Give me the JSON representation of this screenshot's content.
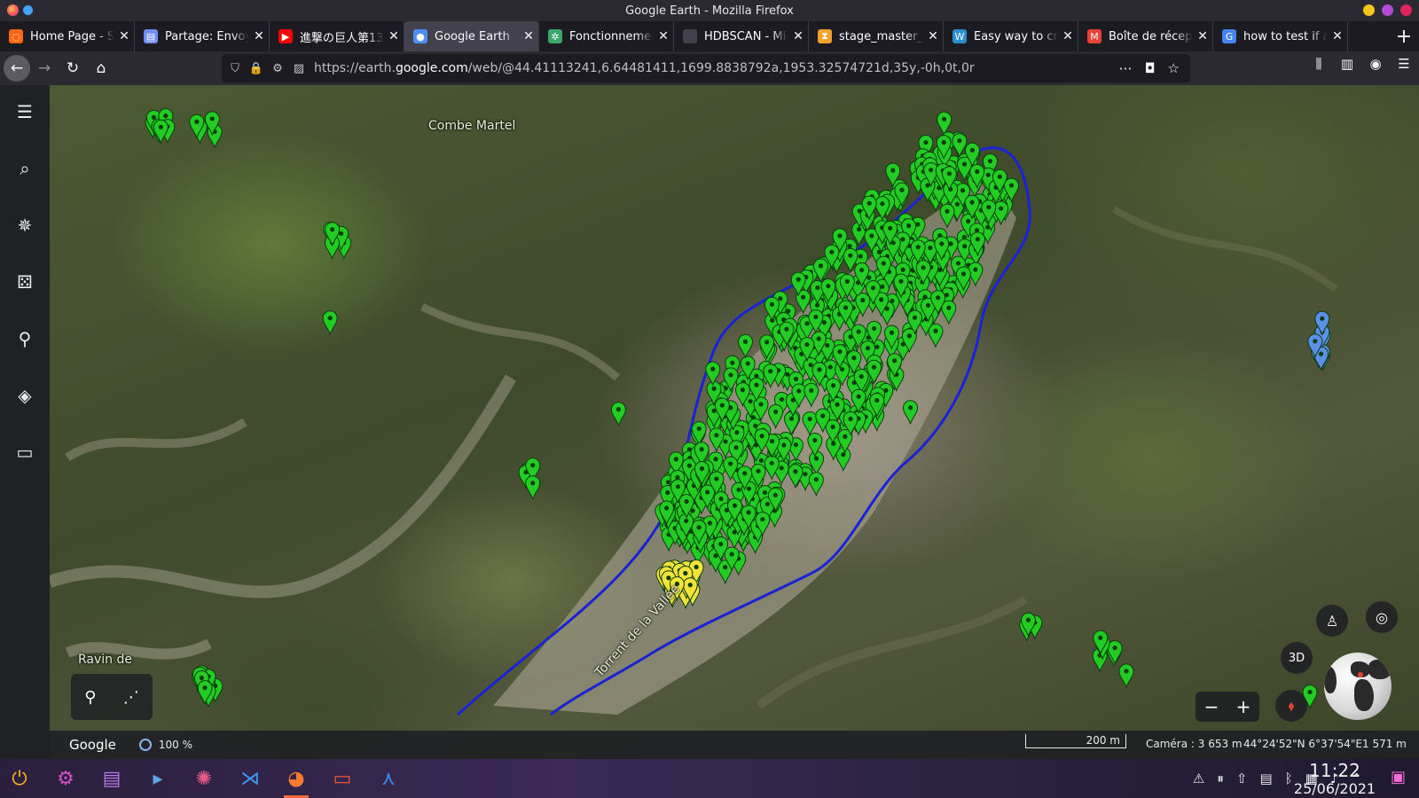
{
  "window": {
    "title": "Google Earth - Mozilla Firefox"
  },
  "tabs": [
    {
      "label": "Home Page - Sc",
      "icon": "spinner-icon",
      "color": "#ff6611"
    },
    {
      "label": "Partage: Envoy",
      "icon": "doc-icon",
      "color": "#6f8ef5"
    },
    {
      "label": "進撃の巨人第13",
      "icon": "youtube-icon",
      "color": "#ff0000"
    },
    {
      "label": "Google Earth",
      "icon": "earth-icon",
      "color": "#4f8ef7",
      "active": true
    },
    {
      "label": "Fonctionnemer",
      "icon": "atom-icon",
      "color": "#3aa86a"
    },
    {
      "label": "HDBSCAN - Michae",
      "icon": "blank-icon",
      "color": "#42414d"
    },
    {
      "label": "stage_master_v",
      "icon": "hourglass-icon",
      "color": "#f2a12c"
    },
    {
      "label": "Easy way to cre",
      "icon": "wordpress-icon",
      "color": "#2a8fd1"
    },
    {
      "label": "Boîte de récept",
      "icon": "gmail-icon",
      "color": "#ea4335"
    },
    {
      "label": "how to test if a",
      "icon": "google-icon",
      "color": "#4285f4"
    }
  ],
  "nav": {
    "url_prefix": "https://earth.",
    "url_domain": "google.com",
    "url_rest": "/web/@44.41113241,6.64481411,1699.8838792a,1953.32574721d,35y,-0h,0t,0r"
  },
  "map": {
    "labels": {
      "combe": "Combe Martel",
      "torrent": "Torrent de la Vallée",
      "ravin": "Ravin de"
    },
    "pin_colors": {
      "green": "#22cc22",
      "yellow": "#f2e23a",
      "blue": "#5b8fe8",
      "outline": "#0a3d0a"
    },
    "polygon_color": "#1a22d6"
  },
  "controls": {
    "view_mode": "3D"
  },
  "status": {
    "brand": "Google",
    "loading": "100 %",
    "scale": "200 m",
    "camera": "Caméra : 3 653 m",
    "coords": "44°24'52\"N 6°37'54\"E",
    "elevation": "1 571 m"
  },
  "taskbar": {
    "time": "11:22",
    "date": "25/06/2021"
  }
}
